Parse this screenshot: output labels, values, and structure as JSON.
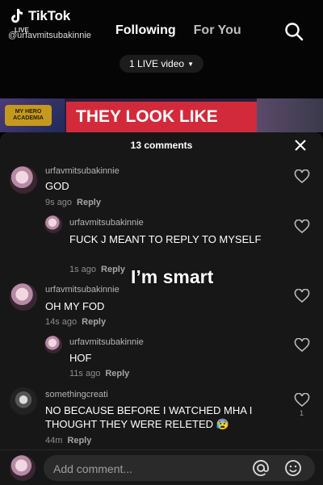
{
  "header": {
    "app_name": "TikTok",
    "username_watermark": "@urfavmitsubakinnie",
    "live_tag": "LIVE",
    "tabs": [
      "Following",
      "For You"
    ],
    "live_pill": "1 LIVE video",
    "icons": {
      "logo": "tiktok-logo-icon",
      "search": "search-icon"
    }
  },
  "video": {
    "banner_text": "THEY LOOK LIKE",
    "logo_text": "MY HERO ACADEMIA"
  },
  "comments_panel": {
    "count_label": "13 comments",
    "comments": [
      {
        "user": "urfavmitsubakinnie",
        "text": "GOD",
        "time": "9s ago",
        "reply": "Reply"
      },
      {
        "user": "urfavmitsubakinnie",
        "text": "FUCK J MEANT TO REPLY TO MYSELF",
        "time": "1s ago",
        "reply": "Reply"
      },
      {
        "user": "urfavmitsubakinnie",
        "text": "OH MY FOD",
        "time": "14s ago",
        "reply": "Reply"
      },
      {
        "user": "urfavmitsubakinnie",
        "text": "HOF",
        "time": "11s ago",
        "reply": "Reply"
      },
      {
        "user": "somethingcreati",
        "text": "NO BECAUSE BEFORE I WATCHED MHA I THOUGHT THEY WERE RELETED 😰",
        "time": "44m",
        "reply": "Reply",
        "likes": "1"
      }
    ]
  },
  "overlay_text": "I’m smart",
  "bottom_bar": {
    "placeholder": "Add comment...",
    "icons": {
      "mention": "at-icon",
      "emoji": "emoji-icon"
    }
  },
  "colors": {
    "panel_bg": "#171717",
    "banner_red": "#d32a3b",
    "muted_text": "#8e8e8e"
  }
}
